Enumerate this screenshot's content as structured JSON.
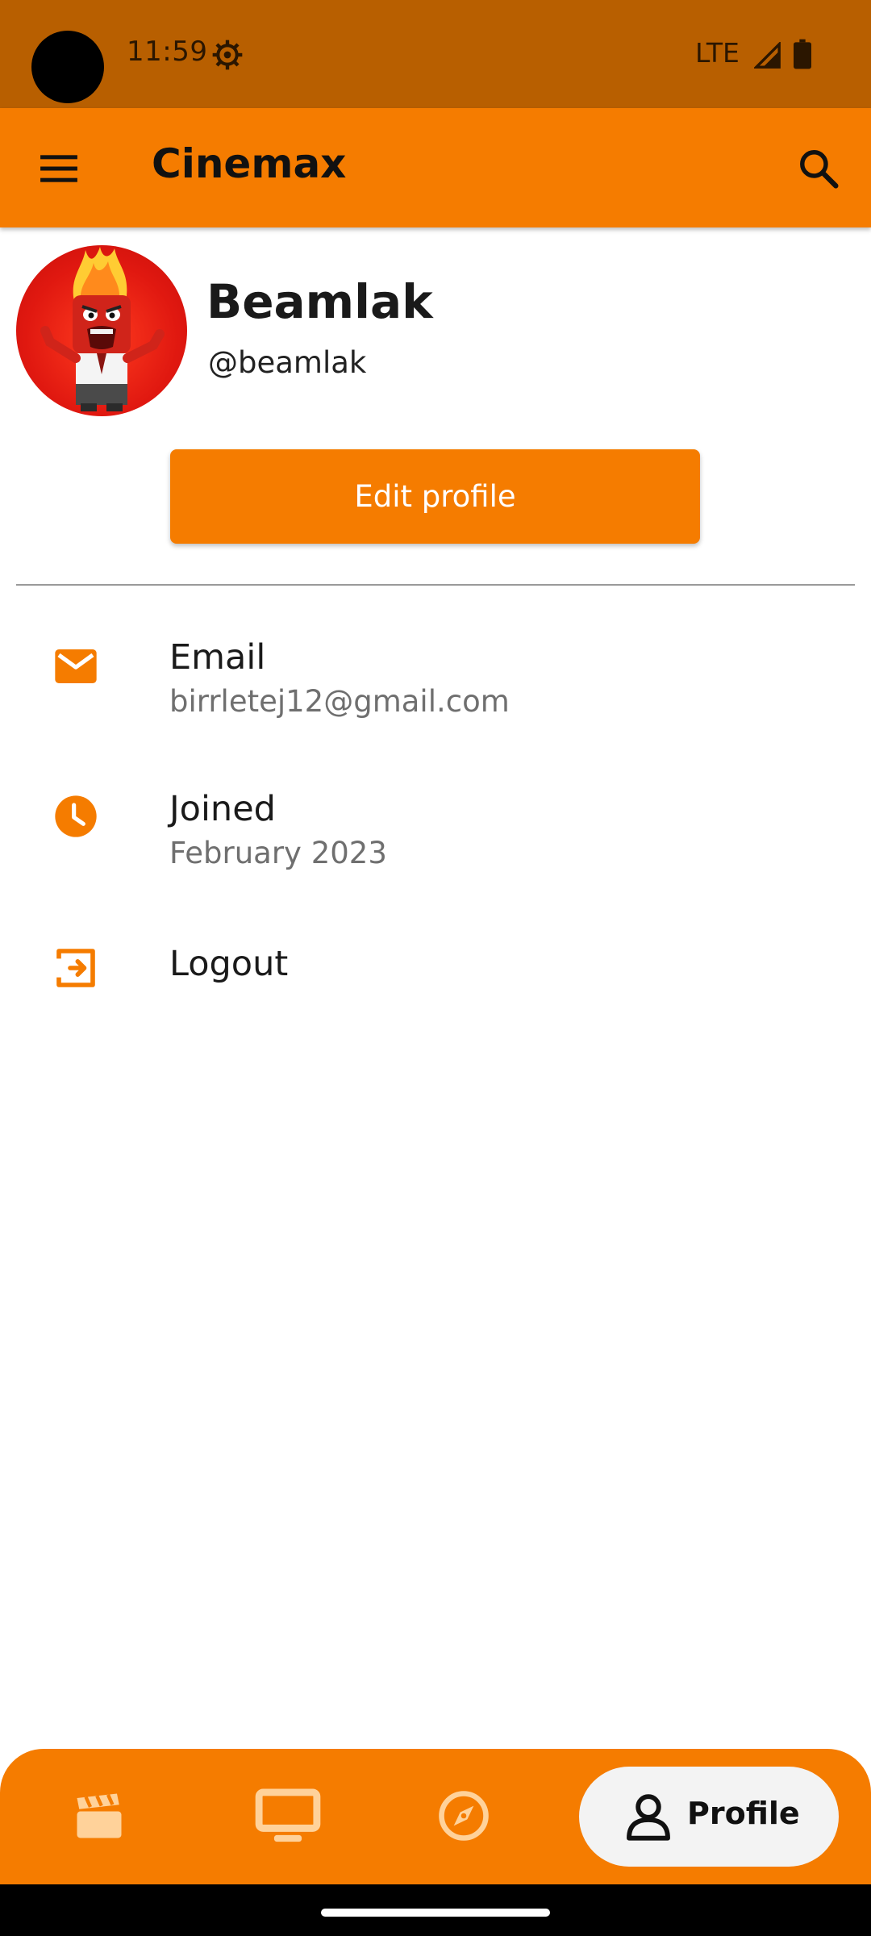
{
  "status_bar": {
    "time": "11:59",
    "network": "LTE"
  },
  "app_bar": {
    "title": "Cinemax",
    "menu_icon": "menu-icon",
    "search_icon": "search-icon"
  },
  "profile": {
    "name": "Beamlak",
    "handle": "@beamlak",
    "edit_button_label": "Edit profile"
  },
  "info_items": [
    {
      "icon": "email-icon",
      "label": "Email",
      "value": "birrletej12@gmail.com"
    },
    {
      "icon": "clock-icon",
      "label": "Joined",
      "value": "February 2023"
    },
    {
      "icon": "logout-icon",
      "label": "Logout",
      "value": ""
    }
  ],
  "bottom_nav": {
    "items": [
      {
        "icon": "movie-clapper-icon",
        "label": ""
      },
      {
        "icon": "tv-icon",
        "label": ""
      },
      {
        "icon": "compass-icon",
        "label": ""
      },
      {
        "icon": "person-icon",
        "label": "Profile",
        "selected": true
      }
    ]
  },
  "colors": {
    "accent": "#f57c00",
    "status_bar": "#b85f00",
    "nav_selected_bg": "#f3f3f3"
  }
}
